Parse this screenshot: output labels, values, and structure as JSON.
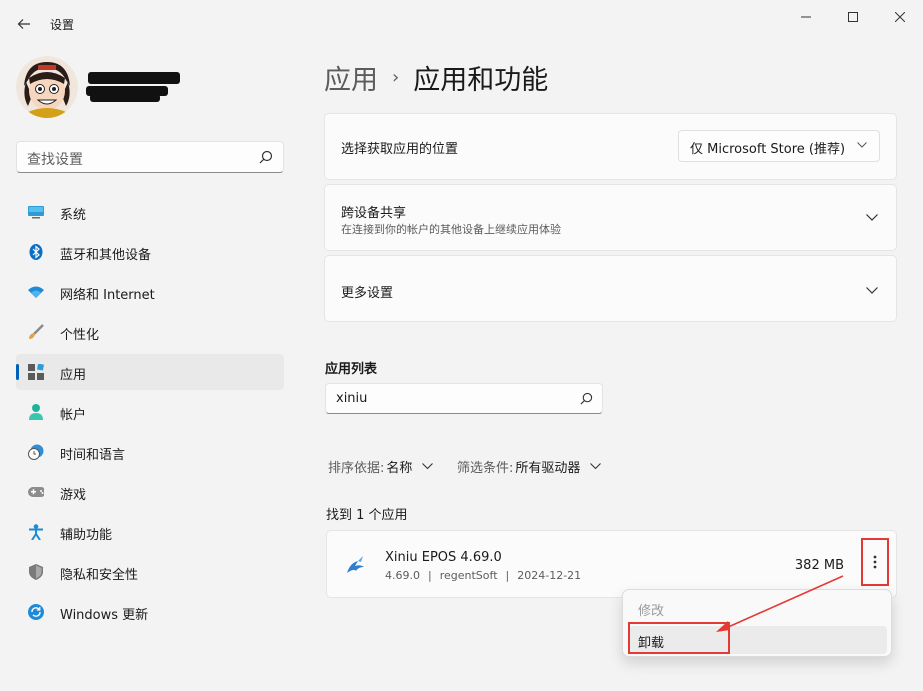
{
  "window": {
    "title": "设置"
  },
  "sidebar": {
    "search_placeholder": "查找设置",
    "items": [
      {
        "label": "系统",
        "icon": "monitor-icon"
      },
      {
        "label": "蓝牙和其他设备",
        "icon": "bluetooth-icon"
      },
      {
        "label": "网络和 Internet",
        "icon": "wifi-icon"
      },
      {
        "label": "个性化",
        "icon": "brush-icon"
      },
      {
        "label": "应用",
        "icon": "apps-icon",
        "active": true
      },
      {
        "label": "帐户",
        "icon": "person-icon"
      },
      {
        "label": "时间和语言",
        "icon": "clock-globe-icon"
      },
      {
        "label": "游戏",
        "icon": "gamepad-icon"
      },
      {
        "label": "辅助功能",
        "icon": "accessibility-icon"
      },
      {
        "label": "隐私和安全性",
        "icon": "shield-icon"
      },
      {
        "label": "Windows 更新",
        "icon": "update-icon"
      }
    ]
  },
  "breadcrumb": {
    "parent": "应用",
    "separator": "›",
    "current": "应用和功能"
  },
  "settings": {
    "location": {
      "title": "选择获取应用的位置",
      "dropdown_value": "仅 Microsoft Store (推荐)"
    },
    "share": {
      "title": "跨设备共享",
      "subtitle": "在连接到你的帐户的其他设备上继续应用体验"
    },
    "more": {
      "title": "更多设置"
    }
  },
  "app_list": {
    "title": "应用列表",
    "search_value": "xiniu",
    "sort_label": "排序依据:",
    "sort_value": "名称",
    "filter_label": "筛选条件:",
    "filter_value": "所有驱动器",
    "found_text": "找到 1 个应用",
    "apps": [
      {
        "name": "Xiniu EPOS 4.69.0",
        "version": "4.69.0",
        "publisher": "regentSoft",
        "date": "2024-12-21",
        "size": "382 MB"
      }
    ]
  },
  "context_menu": {
    "modify": "修改",
    "uninstall": "卸载"
  },
  "colors": {
    "accent": "#005fb8",
    "annotation": "#e53935"
  }
}
